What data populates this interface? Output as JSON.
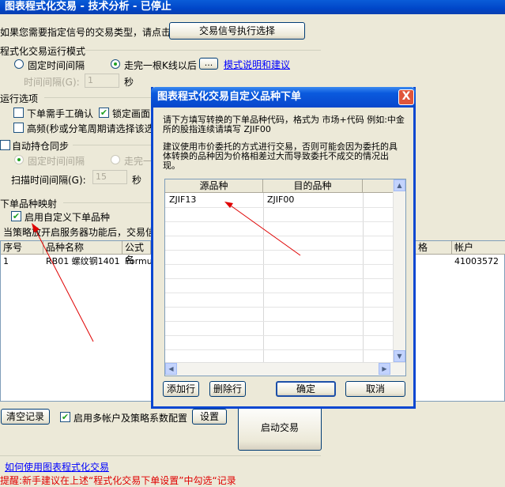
{
  "window": {
    "title": "图表程式化交易 - 技术分析 - 已停止"
  },
  "top_prompt": {
    "text": "如果您需要指定信号的交易类型，请点击",
    "button": "交易信号执行选择"
  },
  "run_mode": {
    "group_label": "程式化交易运行模式",
    "fixed_interval_label": "固定时间间隔",
    "per_k_label": "走完一根K线以后",
    "ellipsis_button": "...",
    "mode_link": "模式说明和建议",
    "interval_label": "时间间隔(G):",
    "interval_value": "1",
    "interval_unit": "秒"
  },
  "run_options": {
    "group_label": "运行选项",
    "manual_confirm_label": "下单需手工确认",
    "lock_label": "锁定画面",
    "high_freq_label": "高频(秒或分笔周期请选择该选"
  },
  "auto_sync": {
    "label": "自动持仓同步",
    "fixed_label": "固定时间间隔",
    "per_k_label": "走完一",
    "scan_label": "扫描时间间隔(G):",
    "scan_value": "15",
    "scan_unit": "秒"
  },
  "mapping": {
    "group_label": "下单品种映射",
    "enable_label": "启用自定义下单品种",
    "note": "当策略放开启服务器功能后，交易信"
  },
  "main_table": {
    "headers": [
      "序号",
      "品种名称",
      "公式名",
      "格",
      "帐户"
    ],
    "rows": [
      [
        "1",
        "RB01 螺纹钢1401",
        "Formu",
        "",
        "41003572"
      ]
    ]
  },
  "bottom": {
    "clear_button": "清空记录",
    "multi_account_label": "启用多帐户及策略系数配置",
    "settings_button": "设置",
    "start_button": "启动交易",
    "help_link": "如何使用图表程式化交易",
    "tip": "提醒:新手建议在上述“程式化交易下单设置”中勾选“记录"
  },
  "dialog": {
    "title": "图表程式化交易自定义品种下单",
    "close": "X",
    "instruction": "请下方填写转换的下单品种代码，格式为 市场+代码 例如:中金所的股指连续请填写 ZJIF00",
    "warning": "建议使用市价委托的方式进行交易，否则可能会因为委托的具体转换的品种因为价格相差过大而导致委托不成交的情况出现。",
    "grid_headers": [
      "源品种",
      "目的品种"
    ],
    "grid_rows": [
      [
        "ZJIF13",
        "ZJIF00"
      ]
    ],
    "add_button": "添加行",
    "delete_button": "删除行",
    "ok_button": "确定",
    "cancel_button": "取消"
  },
  "colors": {
    "title_blue": "#0a5cd8",
    "link_blue": "#0000ff",
    "arrow_red": "#e00000",
    "tip_red": "#e00000"
  }
}
